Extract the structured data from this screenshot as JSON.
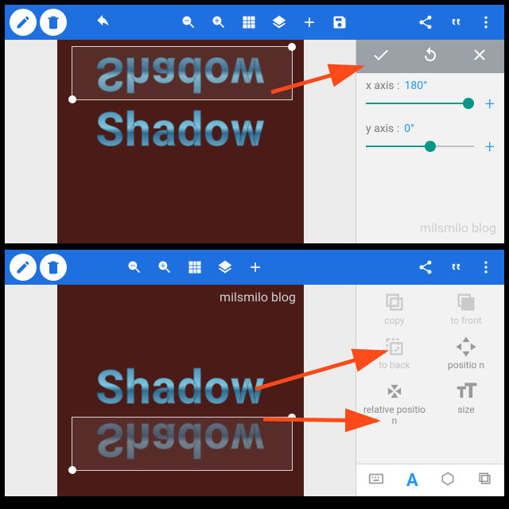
{
  "word": "Shadow",
  "watermark": "milsmilo blog",
  "toolbar": {
    "edit": "edit",
    "delete": "delete",
    "undo": "undo",
    "zoomout": "zoom-out",
    "zoomin": "zoom-in",
    "grid": "grid",
    "layers": "layers",
    "add": "add",
    "save": "save",
    "share": "share",
    "quote": "quote",
    "more": "more"
  },
  "rotationPanel": {
    "confirm": "confirm",
    "reset": "reset",
    "close": "close",
    "x_label": "x axis :",
    "x_value": "180°",
    "y_label": "y axis :",
    "y_value": "0°",
    "x_fill_pct": 100,
    "y_fill_pct": 50
  },
  "actionPanel": {
    "items": [
      {
        "key": "copy",
        "label": "copy"
      },
      {
        "key": "to_front",
        "label": "to front"
      },
      {
        "key": "to_back",
        "label": "to back"
      },
      {
        "key": "position",
        "label": "positio n"
      },
      {
        "key": "relative_position",
        "label": "relative positio n"
      },
      {
        "key": "size",
        "label": "size"
      }
    ],
    "tabs": {
      "text": "A"
    }
  }
}
